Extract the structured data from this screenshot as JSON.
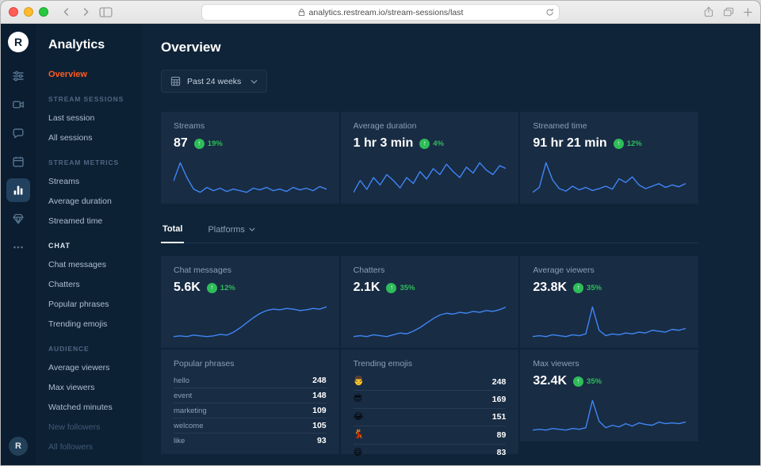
{
  "browser": {
    "url": "analytics.restream.io/stream-sessions/last"
  },
  "colors": {
    "accent_orange": "#ff5c1f",
    "chart_line": "#3f86f5",
    "positive_green": "#2ebd59"
  },
  "rail": {
    "logo_letter": "R",
    "avatar_letter": "R"
  },
  "sidebar": {
    "title": "Analytics",
    "overview_label": "Overview",
    "sections": [
      {
        "header": "STREAM SESSIONS",
        "items": [
          "Last session",
          "All sessions"
        ]
      },
      {
        "header": "STREAM METRICS",
        "items": [
          "Streams",
          "Average duration",
          "Streamed time"
        ]
      },
      {
        "header": "CHAT",
        "items": [
          "Chat messages",
          "Chatters",
          "Popular phrases",
          "Trending emojis"
        ]
      },
      {
        "header": "AUDIENCE",
        "items": [
          "Average viewers",
          "Max viewers",
          "Watched minutes",
          "New followers",
          "All followers"
        ]
      }
    ]
  },
  "main": {
    "title": "Overview",
    "range_filter_label": "Past 24 weeks",
    "tabs": {
      "total": "Total",
      "platforms": "Platforms"
    }
  },
  "stats": {
    "streams": {
      "label": "Streams",
      "value": "87",
      "delta": "19%"
    },
    "average_duration": {
      "label": "Average duration",
      "value": "1 hr 3 min",
      "delta": "4%"
    },
    "streamed_time": {
      "label": "Streamed time",
      "value": "91 hr 21 min",
      "delta": "12%"
    },
    "chat_messages": {
      "label": "Chat messages",
      "value": "5.6K",
      "delta": "12%"
    },
    "chatters": {
      "label": "Chatters",
      "value": "2.1K",
      "delta": "35%"
    },
    "average_viewers": {
      "label": "Average viewers",
      "value": "23.8K",
      "delta": "35%"
    },
    "max_viewers": {
      "label": "Max viewers",
      "value": "32.4K",
      "delta": "35%"
    }
  },
  "popular_phrases": {
    "title": "Popular phrases",
    "rows": [
      {
        "label": "hello",
        "value": "248"
      },
      {
        "label": "event",
        "value": "148"
      },
      {
        "label": "marketing",
        "value": "109"
      },
      {
        "label": "welcome",
        "value": "105"
      },
      {
        "label": "like",
        "value": "93"
      }
    ]
  },
  "trending_emojis": {
    "title": "Trending emojis",
    "rows": [
      {
        "emoji": "👨",
        "value": "248"
      },
      {
        "emoji": "😎",
        "value": "169"
      },
      {
        "emoji": "😂",
        "value": "151"
      },
      {
        "emoji": "💃",
        "value": "89"
      },
      {
        "emoji": "😄",
        "value": "83"
      }
    ]
  },
  "chart_data": [
    {
      "type": "line",
      "name": "streams",
      "title": "Streams — past 24 weeks",
      "x_unit": "weeks",
      "values": [
        44,
        66,
        48,
        34,
        30,
        36,
        32,
        35,
        31,
        34,
        32,
        30,
        35,
        33,
        36,
        32,
        34,
        31,
        36,
        33,
        35,
        32,
        37,
        34
      ]
    },
    {
      "type": "line",
      "name": "average_duration",
      "title": "Average duration — past 24 weeks",
      "x_unit": "weeks",
      "values": [
        28,
        36,
        30,
        38,
        33,
        40,
        36,
        31,
        38,
        34,
        42,
        37,
        44,
        40,
        47,
        42,
        38,
        45,
        41,
        48,
        43,
        40,
        46,
        44
      ]
    },
    {
      "type": "line",
      "name": "streamed_time",
      "title": "Streamed time — past 24 weeks",
      "x_unit": "weeks",
      "values": [
        30,
        38,
        78,
        50,
        36,
        32,
        40,
        34,
        38,
        33,
        36,
        40,
        35,
        52,
        46,
        55,
        42,
        36,
        40,
        44,
        38,
        42,
        39,
        44
      ]
    },
    {
      "type": "line",
      "name": "chat_messages",
      "title": "Chat messages — past 24 weeks",
      "x_unit": "weeks",
      "values": [
        14,
        15,
        14,
        16,
        15,
        14,
        15,
        17,
        16,
        20,
        26,
        33,
        40,
        46,
        50,
        52,
        51,
        53,
        52,
        50,
        51,
        53,
        52,
        55
      ]
    },
    {
      "type": "line",
      "name": "chatters",
      "title": "Chatters — past 24 weeks",
      "x_unit": "weeks",
      "values": [
        12,
        13,
        12,
        14,
        13,
        12,
        14,
        16,
        15,
        18,
        22,
        27,
        32,
        36,
        38,
        37,
        39,
        38,
        40,
        39,
        41,
        40,
        42,
        45
      ]
    },
    {
      "type": "line",
      "name": "average_viewers",
      "title": "Average viewers — past 24 weeks",
      "x_unit": "weeks",
      "values": [
        15,
        16,
        15,
        17,
        16,
        15,
        17,
        16,
        18,
        48,
        22,
        16,
        18,
        17,
        19,
        18,
        20,
        19,
        22,
        21,
        20,
        23,
        22,
        24
      ]
    },
    {
      "type": "line",
      "name": "max_viewers",
      "title": "Max viewers — past 24 weeks",
      "x_unit": "weeks",
      "values": [
        13,
        14,
        13,
        15,
        14,
        13,
        15,
        14,
        16,
        50,
        24,
        16,
        19,
        17,
        21,
        18,
        22,
        20,
        19,
        23,
        21,
        22,
        21,
        23
      ]
    }
  ]
}
